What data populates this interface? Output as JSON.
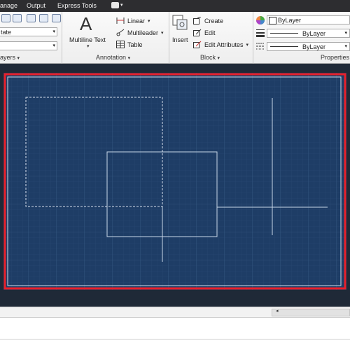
{
  "menubar": {
    "items": [
      "anage",
      "Output",
      "Express Tools"
    ]
  },
  "layers": {
    "combo1": "tate",
    "combo2": "",
    "panel_title": "ayers"
  },
  "annotation": {
    "multiline_text_label": "Multiline Text",
    "multiline_text_glyph": "A",
    "linear_label": "Linear",
    "multileader_label": "Multileader",
    "table_label": "Table",
    "panel_title": "Annotation"
  },
  "block": {
    "insert_label": "Insert",
    "create_label": "Create",
    "edit_label": "Edit",
    "edit_attributes_label": "Edit Attributes",
    "panel_title": "Block"
  },
  "properties": {
    "color_value": "ByLayer",
    "lineweight_value": "ByLayer",
    "linetype_value": "ByLayer",
    "panel_title": "Properties"
  },
  "icons": {
    "caret": "▾",
    "left_arrow": "◂"
  },
  "colors": {
    "drawing_background": "#1e3d66",
    "grid": "#2b4a74",
    "border": "#e8202a",
    "lines": "#c8d6e8"
  }
}
